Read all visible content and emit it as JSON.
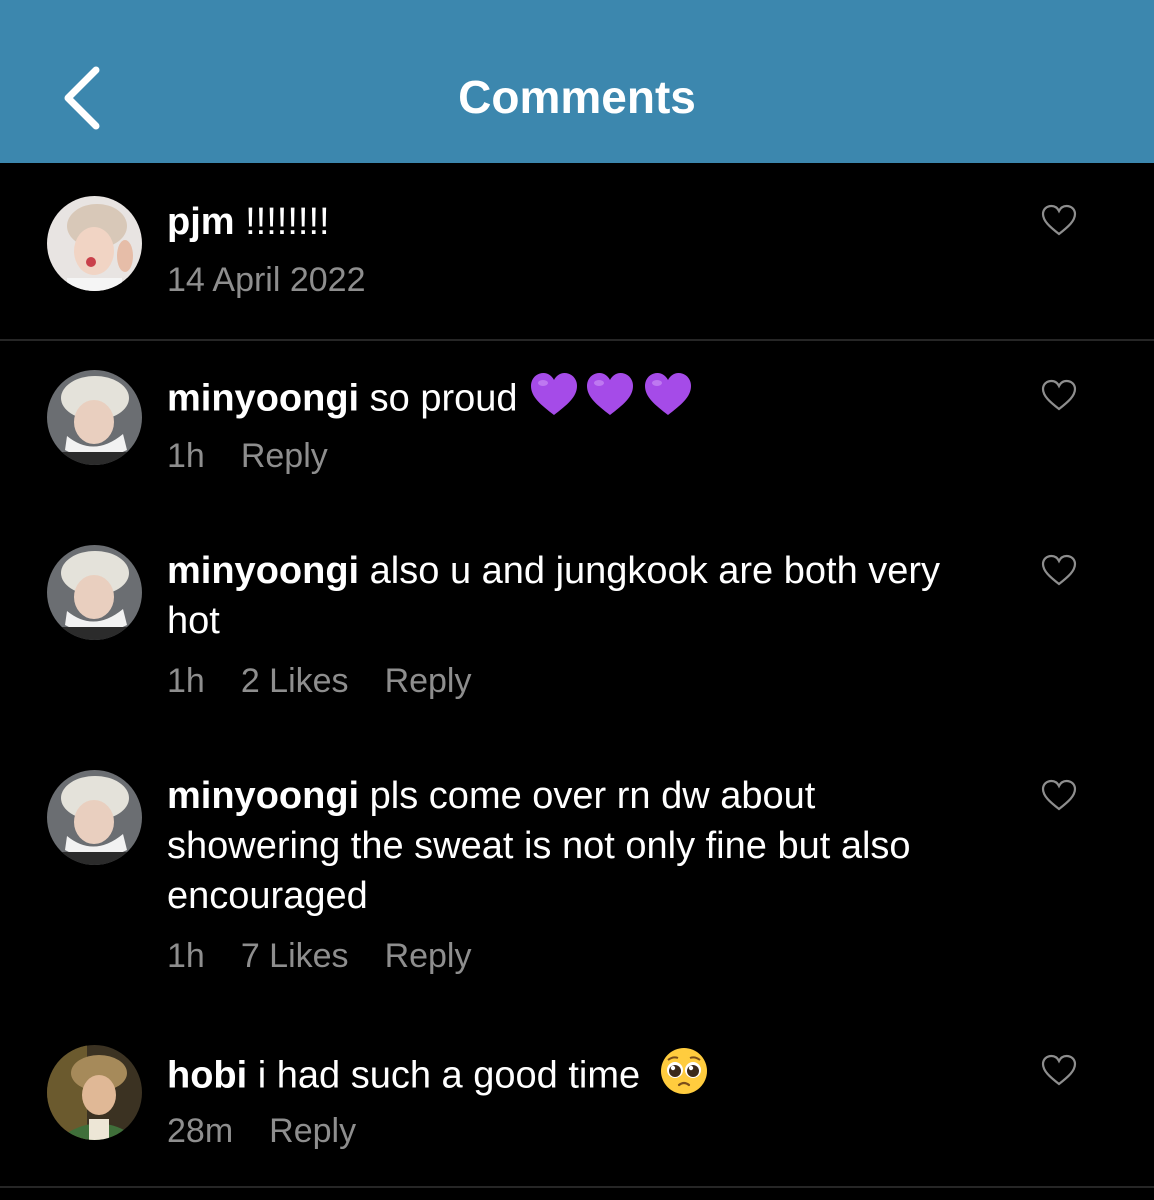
{
  "header": {
    "title": "Comments",
    "background": "#3c87ae"
  },
  "caption": {
    "username": "pjm",
    "text": "!!!!!!!!",
    "date": "14 April 2022"
  },
  "comments": [
    {
      "username": "minyoongi",
      "text": "so proud",
      "emoji": [
        "purple-heart",
        "purple-heart",
        "purple-heart"
      ],
      "time": "1h",
      "likes": "",
      "reply": "Reply"
    },
    {
      "username": "minyoongi",
      "text": "also u and jungkook are both very hot",
      "time": "1h",
      "likes": "2 Likes",
      "reply": "Reply"
    },
    {
      "username": "minyoongi",
      "text": "pls come over rn dw about showering the sweat is not only fine but also encouraged",
      "time": "1h",
      "likes": "7 Likes",
      "reply": "Reply"
    },
    {
      "username": "hobi",
      "text": "i had such a good time",
      "emoji": [
        "pleading-face"
      ],
      "time": "28m",
      "likes": "",
      "reply": "Reply"
    }
  ],
  "icons": {
    "back": "chevron-left-icon",
    "like": "heart-outline-icon"
  },
  "colors": {
    "meta_text": "#8e8e8e",
    "purple_heart": "#a54be8"
  }
}
